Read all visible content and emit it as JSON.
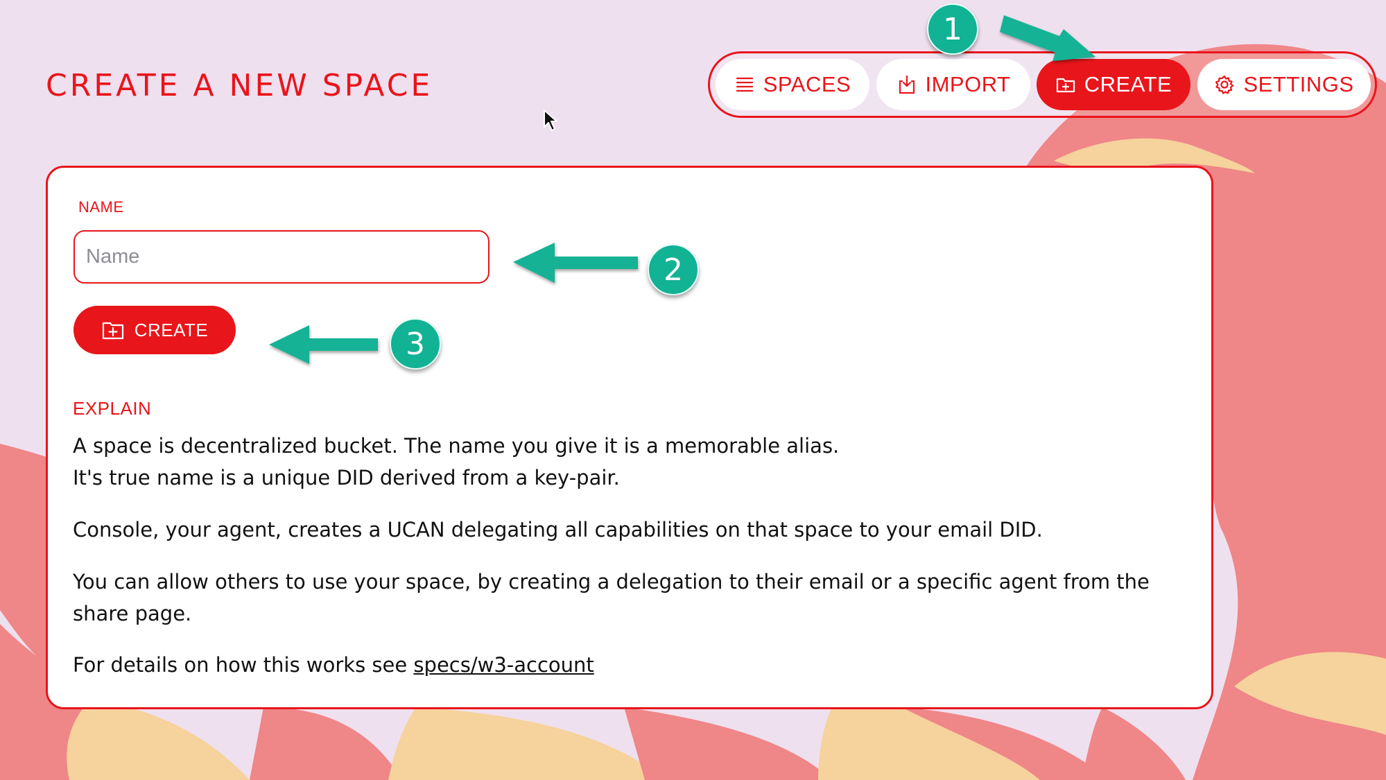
{
  "page": {
    "title": "CREATE A NEW SPACE"
  },
  "nav": {
    "items": [
      {
        "label": "SPACES",
        "icon": "list-icon",
        "active": false
      },
      {
        "label": "IMPORT",
        "icon": "import-icon",
        "active": false
      },
      {
        "label": "CREATE",
        "icon": "folder-plus-icon",
        "active": true
      },
      {
        "label": "SETTINGS",
        "icon": "gear-icon",
        "active": false
      }
    ]
  },
  "form": {
    "name_label": "NAME",
    "name_placeholder": "Name",
    "name_value": "",
    "create_label": "CREATE"
  },
  "explain": {
    "heading": "EXPLAIN",
    "paragraph1_line1": "A space is decentralized bucket. The name you give it is a memorable alias.",
    "paragraph1_line2": "It's true name is a unique DID derived from a key-pair.",
    "paragraph2": "Console, your agent, creates a UCAN delegating all capabilities on that space to your email DID.",
    "paragraph3": "You can allow others to use your space, by creating a delegation to their email or a specific agent from the share page.",
    "paragraph4_prefix": "For details on how this works see ",
    "paragraph4_link": "specs/w3-account"
  },
  "annotations": {
    "badges": [
      "1",
      "2",
      "3"
    ]
  },
  "colors": {
    "accent": "#e8151b",
    "background": "#efe0ef",
    "annotation": "#12b295",
    "blob_pink": "#ef8688",
    "blob_yellow": "#f6d29c"
  }
}
